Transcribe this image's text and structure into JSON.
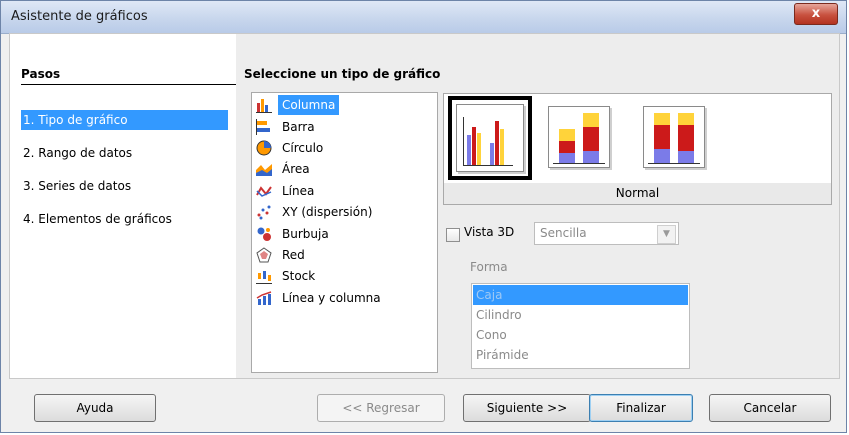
{
  "window": {
    "title": "Asistente de gráficos",
    "close_label": "x"
  },
  "steps": {
    "header": "Pasos",
    "items": [
      {
        "label": "1. Tipo de gráfico",
        "active": true
      },
      {
        "label": "2. Rango de datos",
        "active": false
      },
      {
        "label": "3. Series de datos",
        "active": false
      },
      {
        "label": "4. Elementos de gráficos",
        "active": false
      }
    ]
  },
  "main": {
    "header": "Seleccione un tipo de gráfico",
    "chart_types": [
      {
        "label": "Columna",
        "icon": "column-chart-icon",
        "selected": true
      },
      {
        "label": "Barra",
        "icon": "bar-chart-icon"
      },
      {
        "label": "Círculo",
        "icon": "pie-chart-icon"
      },
      {
        "label": "Área",
        "icon": "area-chart-icon"
      },
      {
        "label": "Línea",
        "icon": "line-chart-icon"
      },
      {
        "label": "XY (dispersión)",
        "icon": "scatter-chart-icon"
      },
      {
        "label": "Burbuja",
        "icon": "bubble-chart-icon"
      },
      {
        "label": "Red",
        "icon": "net-chart-icon"
      },
      {
        "label": "Stock",
        "icon": "stock-chart-icon"
      },
      {
        "label": "Línea y columna",
        "icon": "column-line-chart-icon"
      }
    ],
    "variant_caption": "Normal",
    "vista3d_label": "Vista 3D",
    "vista3d_checked": false,
    "style_select_value": "Sencilla",
    "forma_label": "Forma",
    "shapes": [
      {
        "label": "Caja",
        "selected": true
      },
      {
        "label": "Cilindro"
      },
      {
        "label": "Cono"
      },
      {
        "label": "Pirámide"
      }
    ]
  },
  "buttons": {
    "help": "Ayuda",
    "back": "<< Regresar",
    "next": "Siguiente >>",
    "finish": "Finalizar",
    "cancel": "Cancelar"
  },
  "colors": {
    "selection": "#3399ff",
    "bar_blue": "#7b7be8",
    "bar_red": "#cc1a1a",
    "bar_yellow": "#ffd33a"
  }
}
